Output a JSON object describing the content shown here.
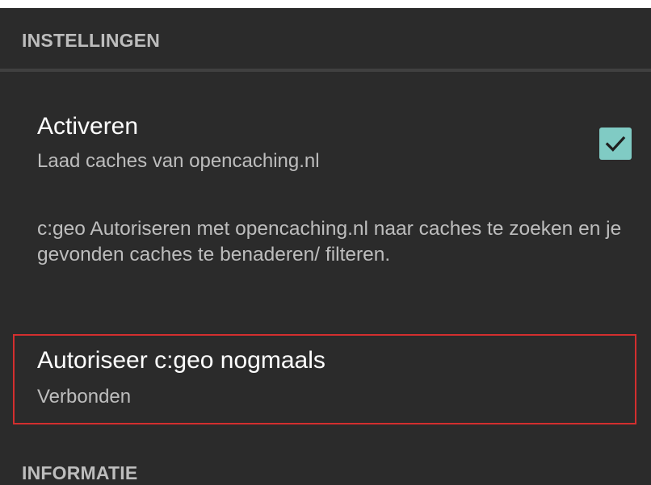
{
  "sections": {
    "settings_header": "INSTELLINGEN",
    "info_header": "INFORMATIE"
  },
  "activate": {
    "title": "Activeren",
    "summary": "Laad caches van opencaching.nl",
    "checked": true
  },
  "description": "c:geo Autoriseren met opencaching.nl naar caches te zoeken en je gevonden caches te benaderen/ filteren.",
  "authorize": {
    "title": "Autoriseer c:geo nogmaals",
    "summary": "Verbonden"
  },
  "colors": {
    "background": "#2b2b2b",
    "accent": "#80cbc4",
    "highlight_border": "#d32f2f",
    "primary_text": "#ffffff",
    "secondary_text": "#bdbdbd"
  },
  "icons": {
    "checkbox": "check-icon"
  }
}
